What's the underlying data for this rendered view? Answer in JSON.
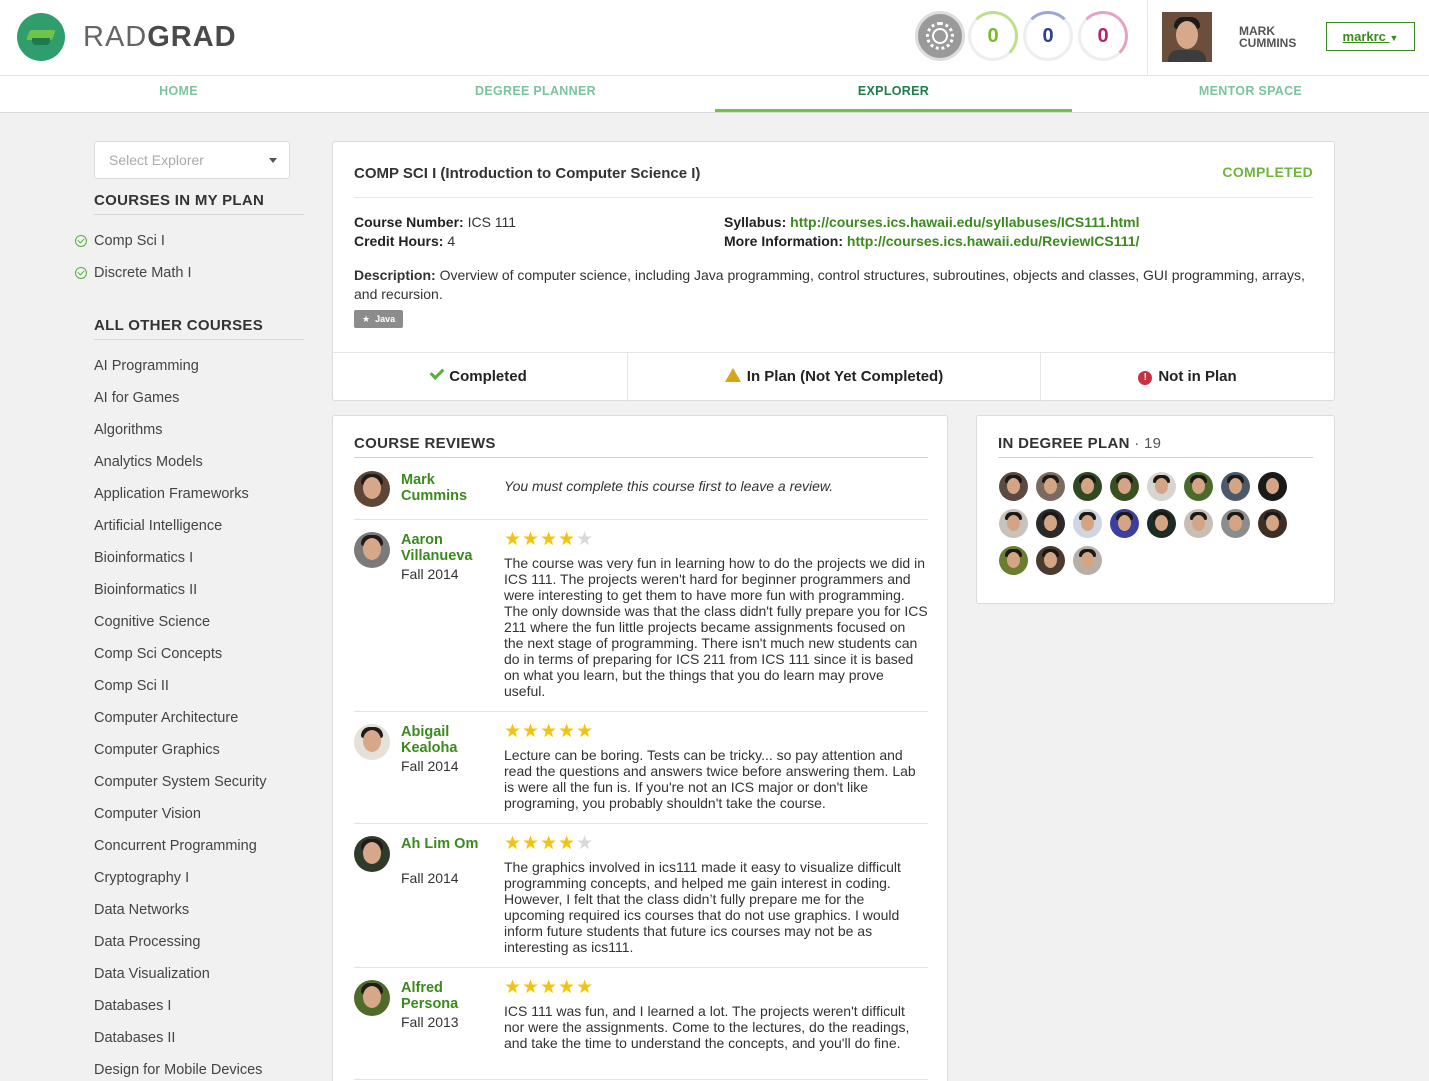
{
  "header": {
    "brand_light": "RAD",
    "brand_bold": "GRAD",
    "stats": [
      "0",
      "0",
      "0"
    ],
    "user_first": "MARK",
    "user_last": "CUMMINS",
    "user_button": "markrc",
    "colors": {
      "level": "#7ab929",
      "innovation": "#2c3f8f",
      "experience": "#b5256e"
    }
  },
  "nav": {
    "tabs": [
      "HOME",
      "DEGREE PLANNER",
      "EXPLORER",
      "MENTOR SPACE"
    ],
    "active": "EXPLORER"
  },
  "sidebar": {
    "select_placeholder": "Select Explorer",
    "my_plan_header": "COURSES IN MY PLAN",
    "my_plan": [
      "Comp Sci I",
      "Discrete Math I"
    ],
    "other_header": "ALL OTHER COURSES",
    "other": [
      "AI Programming",
      "AI for Games",
      "Algorithms",
      "Analytics Models",
      "Application Frameworks",
      "Artificial Intelligence",
      "Bioinformatics I",
      "Bioinformatics II",
      "Cognitive Science",
      "Comp Sci Concepts",
      "Comp Sci II",
      "Computer Architecture",
      "Computer Graphics",
      "Computer System Security",
      "Computer Vision",
      "Concurrent Programming",
      "Cryptography I",
      "Data Networks",
      "Data Processing",
      "Data Visualization",
      "Databases I",
      "Databases II",
      "Design for Mobile Devices"
    ]
  },
  "course": {
    "title": "COMP SCI I (Introduction to Computer Science I)",
    "status": "COMPLETED",
    "number_label": "Course Number:",
    "number": "ICS 111",
    "credits_label": "Credit Hours:",
    "credits": "4",
    "syllabus_label": "Syllabus:",
    "syllabus": "http://courses.ics.hawaii.edu/syllabuses/ICS111.html",
    "more_label": "More Information:",
    "more": "http://courses.ics.hawaii.edu/ReviewICS111/",
    "description_label": "Description:",
    "description": "Overview of computer science, including Java programming, control structures, subroutines, objects and classes, GUI programming, arrays, and recursion.",
    "tag": "Java",
    "plan_options": [
      "Completed",
      "In Plan (Not Yet Completed)",
      "Not in Plan"
    ]
  },
  "reviews": {
    "header": "COURSE REVIEWS",
    "self": {
      "name": "Mark Cummins",
      "note": "You must complete this course first to leave a review."
    },
    "items": [
      {
        "name": "Aaron Villanueva",
        "term": "Fall 2014",
        "rating": 4,
        "text": "The course was very fun in learning how to do the projects we did in ICS 111. The projects weren't hard for beginner programmers and were interesting to get them to have more fun with programming. The only downside was that the class didn't fully prepare you for ICS 211 where the fun little projects became assignments focused on the next stage of programming. There isn't much new students can do in terms of preparing for ICS 211 from ICS 111 since it is based on what you learn, but the things that you do learn may prove useful."
      },
      {
        "name": "Abigail Kealoha",
        "term": "Fall 2014",
        "rating": 5,
        "text": "Lecture can be boring. Tests can be tricky... so pay attention and read the questions and answers twice before answering them. Lab is were all the fun is. If you're not an ICS major or don't like programing, you probably shouldn't take the course."
      },
      {
        "name": "Ah Lim Om",
        "term": "Fall 2014",
        "rating": 4,
        "text": "The graphics involved in ics111 made it easy to visualize difficult programming concepts, and helped me gain interest in coding. However, I felt that the class didn’t fully prepare me for the upcoming required ics courses that do not use graphics. I would inform future students that future ics courses may not be as interesting as ics111."
      },
      {
        "name": "Alfred Persona",
        "term": "Fall 2013",
        "rating": 5,
        "text": "ICS 111 was fun, and I learned a lot. The projects weren't difficult nor were the assignments. Come to the lectures, do the readings, and take the time to understand the concepts, and you'll do fine."
      }
    ]
  },
  "degree_plan": {
    "header": "IN DEGREE PLAN",
    "count": "19"
  }
}
